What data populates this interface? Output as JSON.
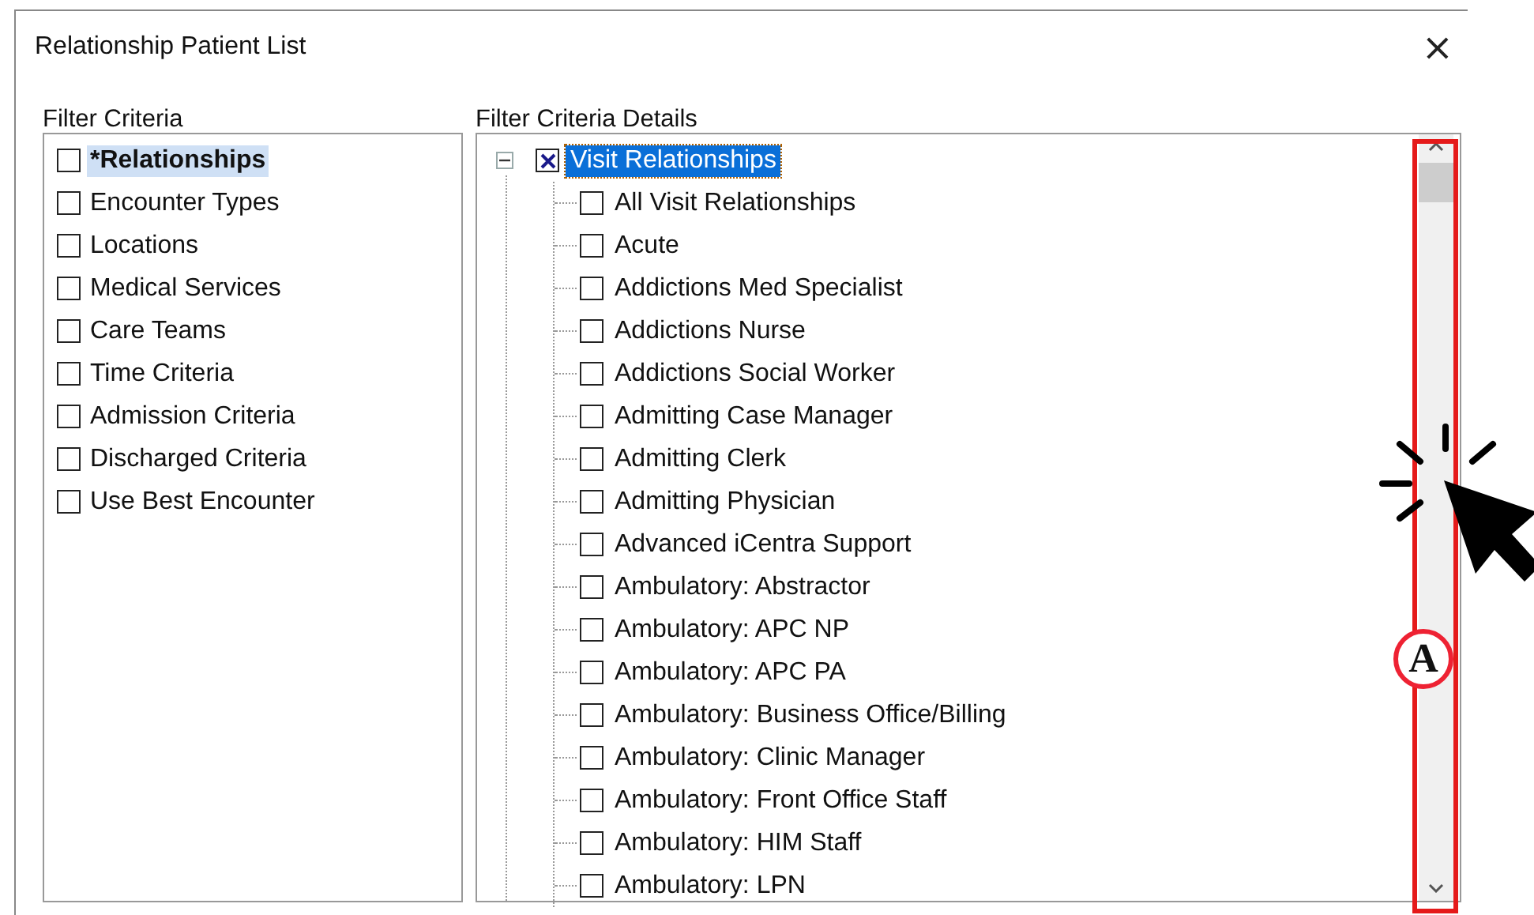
{
  "dialog": {
    "title": "Relationship Patient List",
    "close": "×"
  },
  "filter_criteria": {
    "label": "Filter Criteria",
    "items": [
      {
        "label": "*Relationships",
        "checked": false,
        "selected": true
      },
      {
        "label": "Encounter Types",
        "checked": false,
        "selected": false
      },
      {
        "label": "Locations",
        "checked": false,
        "selected": false
      },
      {
        "label": "Medical Services",
        "checked": false,
        "selected": false
      },
      {
        "label": "Care Teams",
        "checked": false,
        "selected": false
      },
      {
        "label": "Time Criteria",
        "checked": false,
        "selected": false
      },
      {
        "label": "Admission Criteria",
        "checked": false,
        "selected": false
      },
      {
        "label": "Discharged Criteria",
        "checked": false,
        "selected": false
      },
      {
        "label": "Use Best Encounter",
        "checked": false,
        "selected": false
      }
    ]
  },
  "details": {
    "label": "Filter Criteria Details",
    "tree": [
      {
        "label": "Visit Relationships",
        "checked": true,
        "selected": true,
        "expanded": true,
        "children": [
          {
            "label": "All Visit Relationships",
            "checked": false,
            "selected": false
          },
          {
            "label": "Acute",
            "checked": false,
            "selected": false
          },
          {
            "label": "Addictions Med Specialist",
            "checked": false,
            "selected": false
          },
          {
            "label": "Addictions Nurse",
            "checked": false,
            "selected": false
          },
          {
            "label": "Addictions Social Worker",
            "checked": false,
            "selected": false
          },
          {
            "label": "Admitting Case Manager",
            "checked": false,
            "selected": false
          },
          {
            "label": "Admitting Clerk",
            "checked": false,
            "selected": false
          },
          {
            "label": "Admitting Physician",
            "checked": false,
            "selected": false
          },
          {
            "label": "Advanced iCentra Support",
            "checked": false,
            "selected": false
          },
          {
            "label": "Ambulatory: Abstractor",
            "checked": false,
            "selected": false
          },
          {
            "label": "Ambulatory: APC NP",
            "checked": false,
            "selected": false
          },
          {
            "label": "Ambulatory: APC PA",
            "checked": false,
            "selected": false
          },
          {
            "label": "Ambulatory: Business Office/Billing",
            "checked": false,
            "selected": false
          },
          {
            "label": "Ambulatory: Clinic Manager",
            "checked": false,
            "selected": false
          },
          {
            "label": "Ambulatory: Front Office Staff",
            "checked": false,
            "selected": false
          },
          {
            "label": "Ambulatory: HIM Staff",
            "checked": false,
            "selected": false
          },
          {
            "label": "Ambulatory: LPN",
            "checked": false,
            "selected": false
          }
        ]
      }
    ]
  },
  "annotation": {
    "label": "A"
  }
}
